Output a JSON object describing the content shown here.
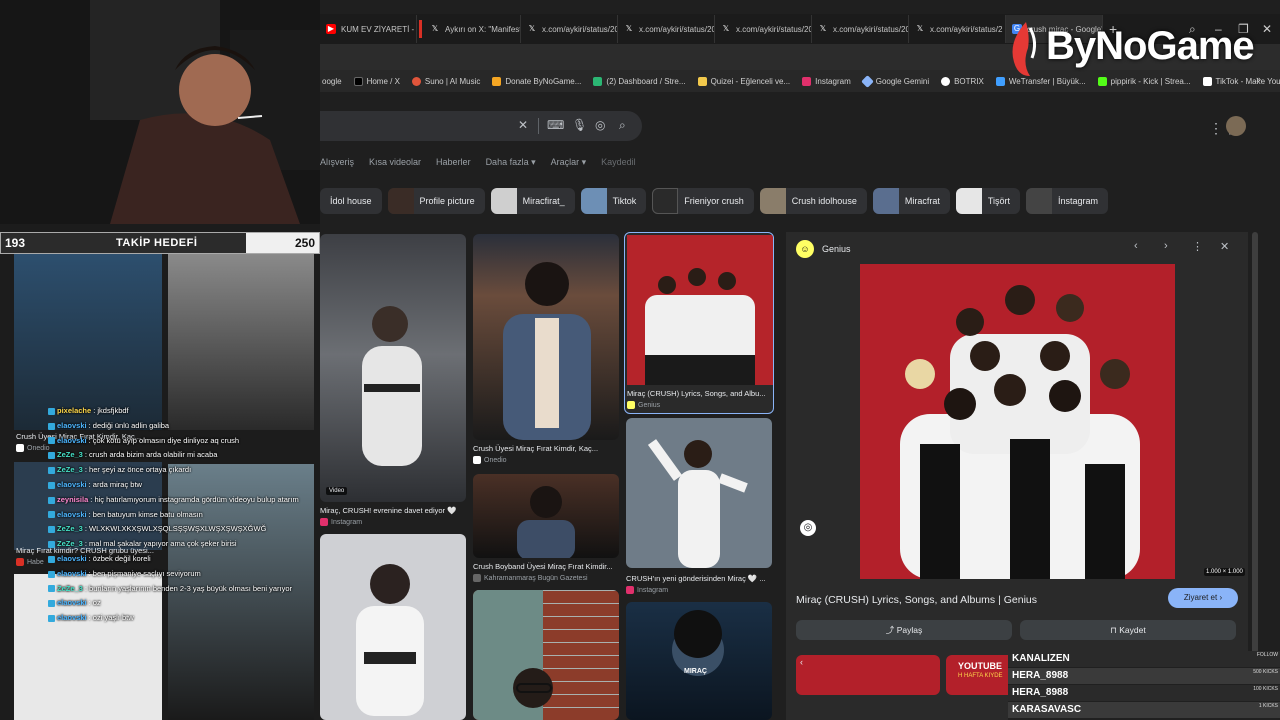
{
  "browser": {
    "tabs": [
      {
        "label": "KUM EV ZİYARETİ - Yo",
        "icon": "youtube-icon",
        "color": "#ff0000"
      },
      {
        "label": "Aykırı on X: \"Manifest",
        "icon": "x-icon",
        "color": "#000000"
      },
      {
        "label": "x.com/aykiri/status/20",
        "icon": "x-icon",
        "color": "#000000"
      },
      {
        "label": "x.com/aykiri/status/20",
        "icon": "x-icon",
        "color": "#000000"
      },
      {
        "label": "x.com/aykiri/status/20",
        "icon": "x-icon",
        "color": "#000000"
      },
      {
        "label": "x.com/aykiri/status/20",
        "icon": "x-icon",
        "color": "#000000"
      },
      {
        "label": "x.com/aykiri/status/2",
        "icon": "x-icon",
        "color": "#000000"
      },
      {
        "label": "crush miraç - Google'da A",
        "icon": "google-icon",
        "color": "#4285f4"
      }
    ],
    "bookmarks": [
      {
        "label": "oogle",
        "color": "#4285f4"
      },
      {
        "label": "Home / X",
        "color": "#000000"
      },
      {
        "label": "Suno | AI Music",
        "color": "#e0553b"
      },
      {
        "label": "Donate ByNoGame...",
        "color": "#f5a623"
      },
      {
        "label": "(2) Dashboard / Stre...",
        "color": "#2bb673"
      },
      {
        "label": "Quizei - Eğlenceli ve...",
        "color": "#f2c94c"
      },
      {
        "label": "Instagram",
        "color": "#e1306c"
      },
      {
        "label": "Google Gemini",
        "color": "#8ab4f8"
      },
      {
        "label": "BOTRIX",
        "color": "#ffffff"
      },
      {
        "label": "WeTransfer | Büyük...",
        "color": "#409fff"
      },
      {
        "label": "pippirik - Kick | Strea...",
        "color": "#53fc18"
      },
      {
        "label": "TikTok - Make Your...",
        "color": "#ffffff"
      }
    ]
  },
  "google": {
    "filters": [
      "Alışveriş",
      "Kısa videolar",
      "Haberler",
      "Daha fazla ▾",
      "Araçlar ▾",
      "Kaydedil"
    ],
    "chips": [
      {
        "label": "İdol house",
        "color": "#6b5a4a"
      },
      {
        "label": "Profile picture",
        "color": "#3a2c26"
      },
      {
        "label": "Miracfirat_",
        "color": "#cfcfcf"
      },
      {
        "label": "Tiktok",
        "color": "#6d8fb5"
      },
      {
        "label": "Frieniyor crush",
        "color": "#2a2a2a"
      },
      {
        "label": "Crush idolhouse",
        "color": "#8a7d6a"
      },
      {
        "label": "Miracfrat",
        "color": "#5a6e8f"
      },
      {
        "label": "Tişört",
        "color": "#e6e6e6"
      },
      {
        "label": "İnstagram",
        "color": "#444444"
      }
    ],
    "results": {
      "r1": {
        "caption": "Crush Üyesi Miraç Fırat Kimdir, Kaç...",
        "source": "Onedio",
        "badge": "Video"
      },
      "r1b": {
        "caption": "Miraç, CRUSH! evrenine davet ediyor 🤍",
        "source": "Instagram"
      },
      "r2": {
        "caption": "Crush Üyesi Miraç Fırat Kimdir, Kaç...",
        "source": "Onedio"
      },
      "r3": {
        "caption": "Crush Boyband Üyesi Miraç Fırat Kimdir...",
        "source": "Kahramanmaraş Bugün Gazetesi"
      },
      "r4": {
        "caption": "Miraç (CRUSH) Lyrics, Songs, and Albu...",
        "source": "Genius"
      },
      "r5": {
        "caption": "CRUSH'ın yeni gönderisinden Miraç 🤍 ...",
        "source": "Instagram"
      },
      "r6": {
        "caption": "MIRAÇ"
      }
    },
    "panel": {
      "source": "Genius",
      "dimensions": "1.000 × 1.000",
      "title": "Miraç (CRUSH) Lyrics, Songs, and Albums | Genius",
      "visit": "Ziyaret et",
      "share": "Paylaş",
      "save": "Kaydet",
      "bottom_thumb_text": "YOUTUBE",
      "bottom_thumb_sub": "H HAFTA KIYDE"
    }
  },
  "stream": {
    "follow_goal": {
      "current": "193",
      "title": "TAKİP HEDEFİ",
      "target": "250",
      "progress": 0.772
    },
    "left_captions": [
      {
        "caption": "Crush Üyesi Miraç Fırat Kimdir, Kaç...",
        "source": "Onedio"
      },
      {
        "caption": "Miraç Fırat kimdir? CRUSH grubu üyesi...",
        "source": "Habe"
      }
    ],
    "chat": [
      {
        "user": "pixelache",
        "msg": ": jkdsfjkbdf",
        "color": "#ffd84a"
      },
      {
        "user": "elaovski",
        "msg": ": dediği ünlü adlin galiba",
        "color": "#4db6ff"
      },
      {
        "user": "elaovski",
        "msg": ": çok kötü ayıp olmasın diye dinliyoz aq crush",
        "color": "#4db6ff"
      },
      {
        "user": "ZeZe_3",
        "msg": ": crush arda bizim arda olabilir mi acaba",
        "color": "#45e0c6"
      },
      {
        "user": "ZeZe_3",
        "msg": ": her şeyi az önce ortaya çıkardı",
        "color": "#45e0c6"
      },
      {
        "user": "elaovski",
        "msg": ": arda miraç btw",
        "color": "#4db6ff"
      },
      {
        "user": "zeynisila",
        "msg": ": hiç hatırlamıyorum instagramda gördüm videoyu bulup atarım",
        "color": "#ff8ad1"
      },
      {
        "user": "elaovski",
        "msg": ": ben batuyum kimse batu olmasın",
        "color": "#4db6ff"
      },
      {
        "user": "ZeZe_3",
        "msg": ": WLXKWLXKXŞWLXŞQLSŞŞWŞXLWŞXŞWŞXĞWĞ",
        "color": "#45e0c6"
      },
      {
        "user": "ZeZe_3",
        "msg": ": mal mal şakalar yapıyor ama çok şeker birisi",
        "color": "#45e0c6"
      },
      {
        "user": "elaovski",
        "msg": ": özbek değil koreli",
        "color": "#4db6ff"
      },
      {
        "user": "elaovski",
        "msg": ": ben pişmaniye saçlıyı seviyorum",
        "color": "#4db6ff"
      },
      {
        "user": "ZeZe_3",
        "msg": ": bunların yaşlarının benden 2-3 yaş büyük olması beni yarıyor",
        "color": "#45e0c6"
      },
      {
        "user": "elaovski",
        "msg": ": oz",
        "color": "#4db6ff"
      },
      {
        "user": "elaovski",
        "msg": ": ozi yaşlı btw",
        "color": "#4db6ff"
      }
    ],
    "logo": "ByNoGame",
    "events": [
      {
        "name": "KANALIZEN",
        "tag": "FOLLOW"
      },
      {
        "name": "HERA_8988",
        "tag": "500 KICKS"
      },
      {
        "name": "HERA_8988",
        "tag": "100 KICKS"
      },
      {
        "name": "KARASAVASC",
        "tag": "1 KICKS"
      }
    ]
  }
}
